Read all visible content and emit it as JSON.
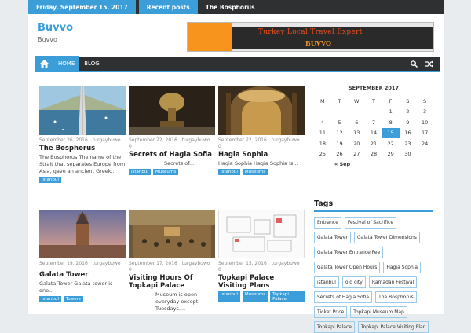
{
  "topbar": {
    "date": "Friday, September 15, 2017",
    "recent_label": "Recent posts",
    "headline": "The Bosphorus"
  },
  "site": {
    "title": "Buvvo",
    "description": "Buvvo"
  },
  "banner": {
    "line1": "Turkey Local Travel Expert",
    "line2": "BUVVO"
  },
  "nav": {
    "items": [
      "HOME",
      "BLOG"
    ]
  },
  "posts": [
    {
      "date": "September 26, 2016",
      "author": "turgaybuwo",
      "comments": "",
      "title": "The Bosphorus",
      "excerpt": "The Bosphorus The name of the Strait that separates Europe from Asia, gave an ancient Greek...",
      "tags": [
        "istanbul"
      ]
    },
    {
      "date": "September 22, 2016",
      "author": "turgaybuwo",
      "comments": "0",
      "title": "Secrets of Hagia Sofia",
      "excerpt": "Secrets of...",
      "tags": [
        "istanbul",
        "Museums"
      ]
    },
    {
      "date": "September 22, 2016",
      "author": "turgaybuwo",
      "comments": "0",
      "title": "Hagia Sophia",
      "excerpt": "Hagia Sophia Hagia Sophia is...",
      "tags": [
        "istanbul",
        "Museums"
      ]
    },
    {
      "date": "September 19, 2016",
      "author": "turgaybuwo",
      "comments": "",
      "title": "Galata Tower",
      "excerpt": "Galata Tower Galata tower is one...",
      "tags": [
        "istanbul",
        "Towers"
      ]
    },
    {
      "date": "September 17, 2016",
      "author": "turgaybuwo",
      "comments": "0",
      "title": "Visiting Hours Of Topkapi Palace",
      "excerpt": "Museum is open everyday except Tuesdays....",
      "tags": []
    },
    {
      "date": "September 15, 2016",
      "author": "turgaybuwo",
      "comments": "0",
      "title": "Topkapi Palace Visiting Plans",
      "excerpt": "",
      "tags": [
        "istanbul",
        "Museums",
        "Topkapi Palace"
      ]
    }
  ],
  "calendar": {
    "caption": "SEPTEMBER 2017",
    "days": [
      "M",
      "T",
      "W",
      "T",
      "F",
      "S",
      "S"
    ],
    "weeks": [
      [
        "",
        "",
        "",
        "",
        "1",
        "2",
        "3"
      ],
      [
        "4",
        "5",
        "6",
        "7",
        "8",
        "9",
        "10"
      ],
      [
        "11",
        "12",
        "13",
        "14",
        "15",
        "16",
        "17"
      ],
      [
        "18",
        "19",
        "20",
        "21",
        "22",
        "23",
        "24"
      ],
      [
        "25",
        "26",
        "27",
        "28",
        "29",
        "30",
        ""
      ]
    ],
    "today": "15",
    "prev": "« Sep"
  },
  "tags_widget": {
    "title": "Tags",
    "tags": [
      "Entrance",
      "Festival of Sacrifice",
      "Galata Tower",
      "Galata Tower Dimensions",
      "Galata Tower Entrance Fee",
      "Galata Tower Open Hours",
      "Hagia Sophia",
      "istanbul",
      "old city",
      "Ramadan Festival",
      "Secrets of Hagia Sofia",
      "The Bosphorus",
      "Ticket Price",
      "Topkapi Museum Map",
      "Topkapi Palace",
      "Topkapi Palace Visiting Plan"
    ]
  }
}
